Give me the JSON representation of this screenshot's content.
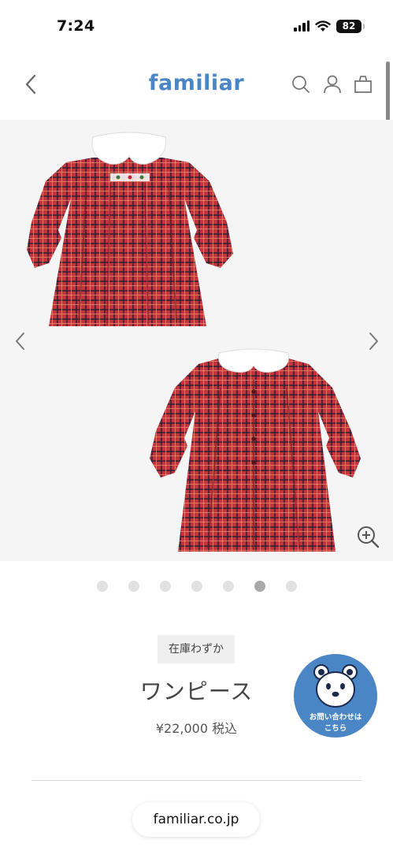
{
  "status_bar": {
    "time": "7:24",
    "battery": "82",
    "icons": [
      "signal-icon",
      "wifi-icon",
      "battery-icon"
    ]
  },
  "header": {
    "logo": "familiar",
    "brand_color": "#4a86c5",
    "icons": [
      "back-chevron-icon",
      "search-icon",
      "account-icon",
      "cart-bag-icon"
    ]
  },
  "gallery": {
    "prev_icon": "chevron-left-icon",
    "next_icon": "chevron-right-icon",
    "zoom_icon": "zoom-in-icon",
    "dot_count": 7,
    "active_dot": 6,
    "image_subject": "red-plaid-dress"
  },
  "product": {
    "stock_badge": "在庫わずか",
    "name": "ワンピース",
    "price": "¥22,000",
    "tax_note": "税込"
  },
  "contact": {
    "line1": "お問い合わせは",
    "line2": "こちら",
    "icon": "bear-icon"
  },
  "url_bar": {
    "domain": "familiar.co.jp"
  }
}
